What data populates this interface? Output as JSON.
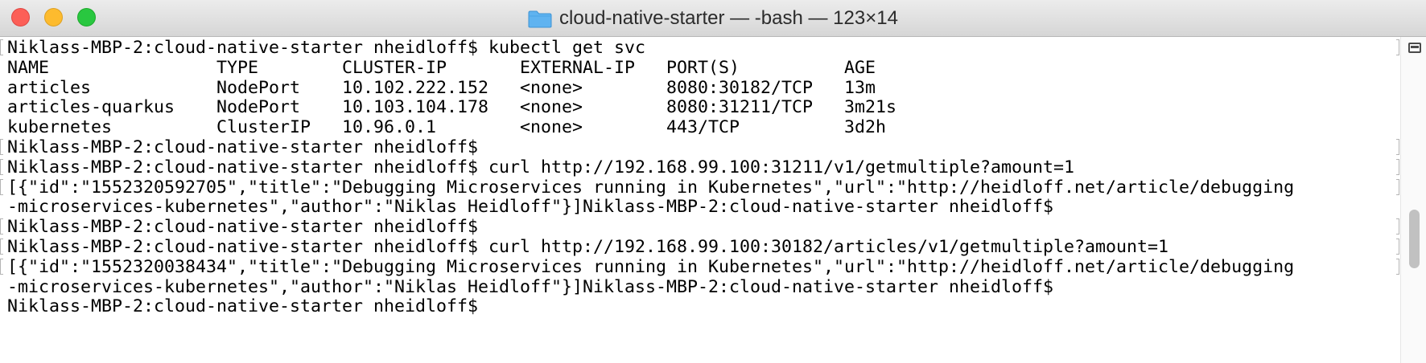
{
  "window": {
    "title": "cloud-native-starter — -bash — 123×14"
  },
  "terminal": {
    "lines": [
      {
        "text": "Niklass-MBP-2:cloud-native-starter nheidloff$ kubectl get svc",
        "marked": true
      },
      {
        "text": "NAME                TYPE        CLUSTER-IP       EXTERNAL-IP   PORT(S)          AGE",
        "marked": false
      },
      {
        "text": "articles            NodePort    10.102.222.152   <none>        8080:30182/TCP   13m",
        "marked": false
      },
      {
        "text": "articles-quarkus    NodePort    10.103.104.178   <none>        8080:31211/TCP   3m21s",
        "marked": false
      },
      {
        "text": "kubernetes          ClusterIP   10.96.0.1        <none>        443/TCP          3d2h",
        "marked": false
      },
      {
        "text": "Niklass-MBP-2:cloud-native-starter nheidloff$",
        "marked": true
      },
      {
        "text": "Niklass-MBP-2:cloud-native-starter nheidloff$ curl http://192.168.99.100:31211/v1/getmultiple?amount=1",
        "marked": true
      },
      {
        "text": "[{\"id\":\"1552320592705\",\"title\":\"Debugging Microservices running in Kubernetes\",\"url\":\"http://heidloff.net/article/debugging",
        "marked": true
      },
      {
        "text": "-microservices-kubernetes\",\"author\":\"Niklas Heidloff\"}]Niklass-MBP-2:cloud-native-starter nheidloff$",
        "marked": false
      },
      {
        "text": "Niklass-MBP-2:cloud-native-starter nheidloff$",
        "marked": true
      },
      {
        "text": "Niklass-MBP-2:cloud-native-starter nheidloff$ curl http://192.168.99.100:30182/articles/v1/getmultiple?amount=1",
        "marked": true
      },
      {
        "text": "[{\"id\":\"1552320038434\",\"title\":\"Debugging Microservices running in Kubernetes\",\"url\":\"http://heidloff.net/article/debugging",
        "marked": true
      },
      {
        "text": "-microservices-kubernetes\",\"author\":\"Niklas Heidloff\"}]Niklass-MBP-2:cloud-native-starter nheidloff$",
        "marked": false
      },
      {
        "text": "Niklass-MBP-2:cloud-native-starter nheidloff$",
        "marked": false
      }
    ]
  },
  "icons": {
    "folder": "folder-icon",
    "scroll": "scroll-indicator-icon"
  },
  "colors": {
    "close": "#fc5f57",
    "minimize": "#fdbb2e",
    "zoom": "#29c740",
    "folder": "#5fb3f0"
  }
}
